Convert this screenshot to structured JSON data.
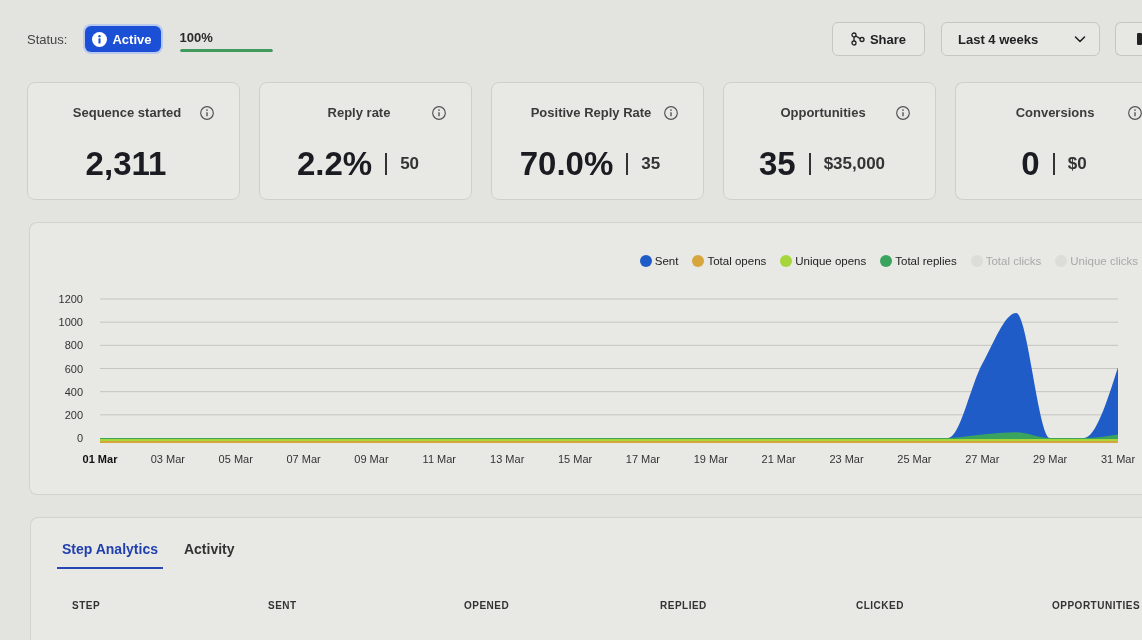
{
  "status": {
    "label": "Status:",
    "badge": "Active",
    "progress": {
      "reading": "100%",
      "level": 1
    }
  },
  "toolbar": {
    "share": "Share",
    "date_range": "Last 4 weeks"
  },
  "metrics": [
    {
      "title": "Sequence started",
      "value": "2,311"
    },
    {
      "title": "Reply rate",
      "value": "2.2%",
      "secondary": "50"
    },
    {
      "title": "Positive Reply Rate",
      "value": "70.0%",
      "secondary": "35"
    },
    {
      "title": "Opportunities",
      "value": "35",
      "secondary": "$35,000"
    },
    {
      "title": "Conversions",
      "value": "0",
      "secondary": "$0"
    }
  ],
  "chart": {
    "chart_data": {
      "type": "area",
      "stacked": false,
      "grid": true,
      "legend": "top-right",
      "categories": [
        "01 Mar",
        null,
        "03 Mar",
        null,
        "05 Mar",
        null,
        "07 Mar",
        null,
        "09 Mar",
        null,
        "11 Mar",
        null,
        "13 Mar",
        null,
        "15 Mar",
        null,
        "17 Mar",
        null,
        "19 Mar",
        null,
        "21 Mar",
        null,
        "23 Mar",
        null,
        "25 Mar",
        null,
        "27 Mar",
        null,
        "29 Mar",
        null,
        "31 Mar"
      ],
      "ylim": [
        0,
        1200
      ],
      "yticks": [
        0,
        200,
        400,
        600,
        800,
        1000,
        1200
      ],
      "series": [
        {
          "name": "Sent",
          "color": "#1f5cc8",
          "values": [
            0,
            0,
            0,
            0,
            0,
            0,
            0,
            0,
            0,
            0,
            0,
            0,
            0,
            0,
            0,
            0,
            0,
            0,
            0,
            0,
            0,
            0,
            0,
            0,
            0,
            0,
            640,
            1080,
            0,
            0,
            610
          ]
        },
        {
          "name": "Total opens",
          "color": "#d6a63c",
          "values": [
            0,
            0,
            0,
            0,
            0,
            0,
            0,
            0,
            0,
            0,
            0,
            0,
            0,
            0,
            0,
            0,
            0,
            0,
            0,
            0,
            0,
            0,
            0,
            0,
            0,
            0,
            0,
            0,
            0,
            0,
            0
          ]
        },
        {
          "name": "Unique opens",
          "color": "#a6d63a",
          "values": [
            0,
            0,
            0,
            0,
            0,
            0,
            0,
            0,
            0,
            0,
            0,
            0,
            0,
            0,
            0,
            0,
            0,
            0,
            0,
            0,
            0,
            0,
            0,
            0,
            0,
            0,
            0,
            0,
            0,
            0,
            0
          ]
        },
        {
          "name": "Total replies",
          "color": "#3aa35e",
          "values": [
            0,
            0,
            0,
            0,
            0,
            0,
            0,
            0,
            0,
            0,
            0,
            0,
            0,
            0,
            0,
            0,
            0,
            0,
            0,
            0,
            0,
            0,
            0,
            0,
            0,
            0,
            30,
            50,
            0,
            0,
            30
          ]
        }
      ]
    },
    "hidden_series": [
      {
        "name": "Total clicks"
      },
      {
        "name": "Unique clicks"
      }
    ]
  },
  "analytics": {
    "tabs": [
      {
        "label": "Step Analytics",
        "selected": true
      },
      {
        "label": "Activity",
        "selected": false
      }
    ],
    "table": {
      "columns": [
        "STEP",
        "SENT",
        "OPENED",
        "REPLIED",
        "CLICKED",
        "OPPORTUNITIES"
      ]
    }
  }
}
